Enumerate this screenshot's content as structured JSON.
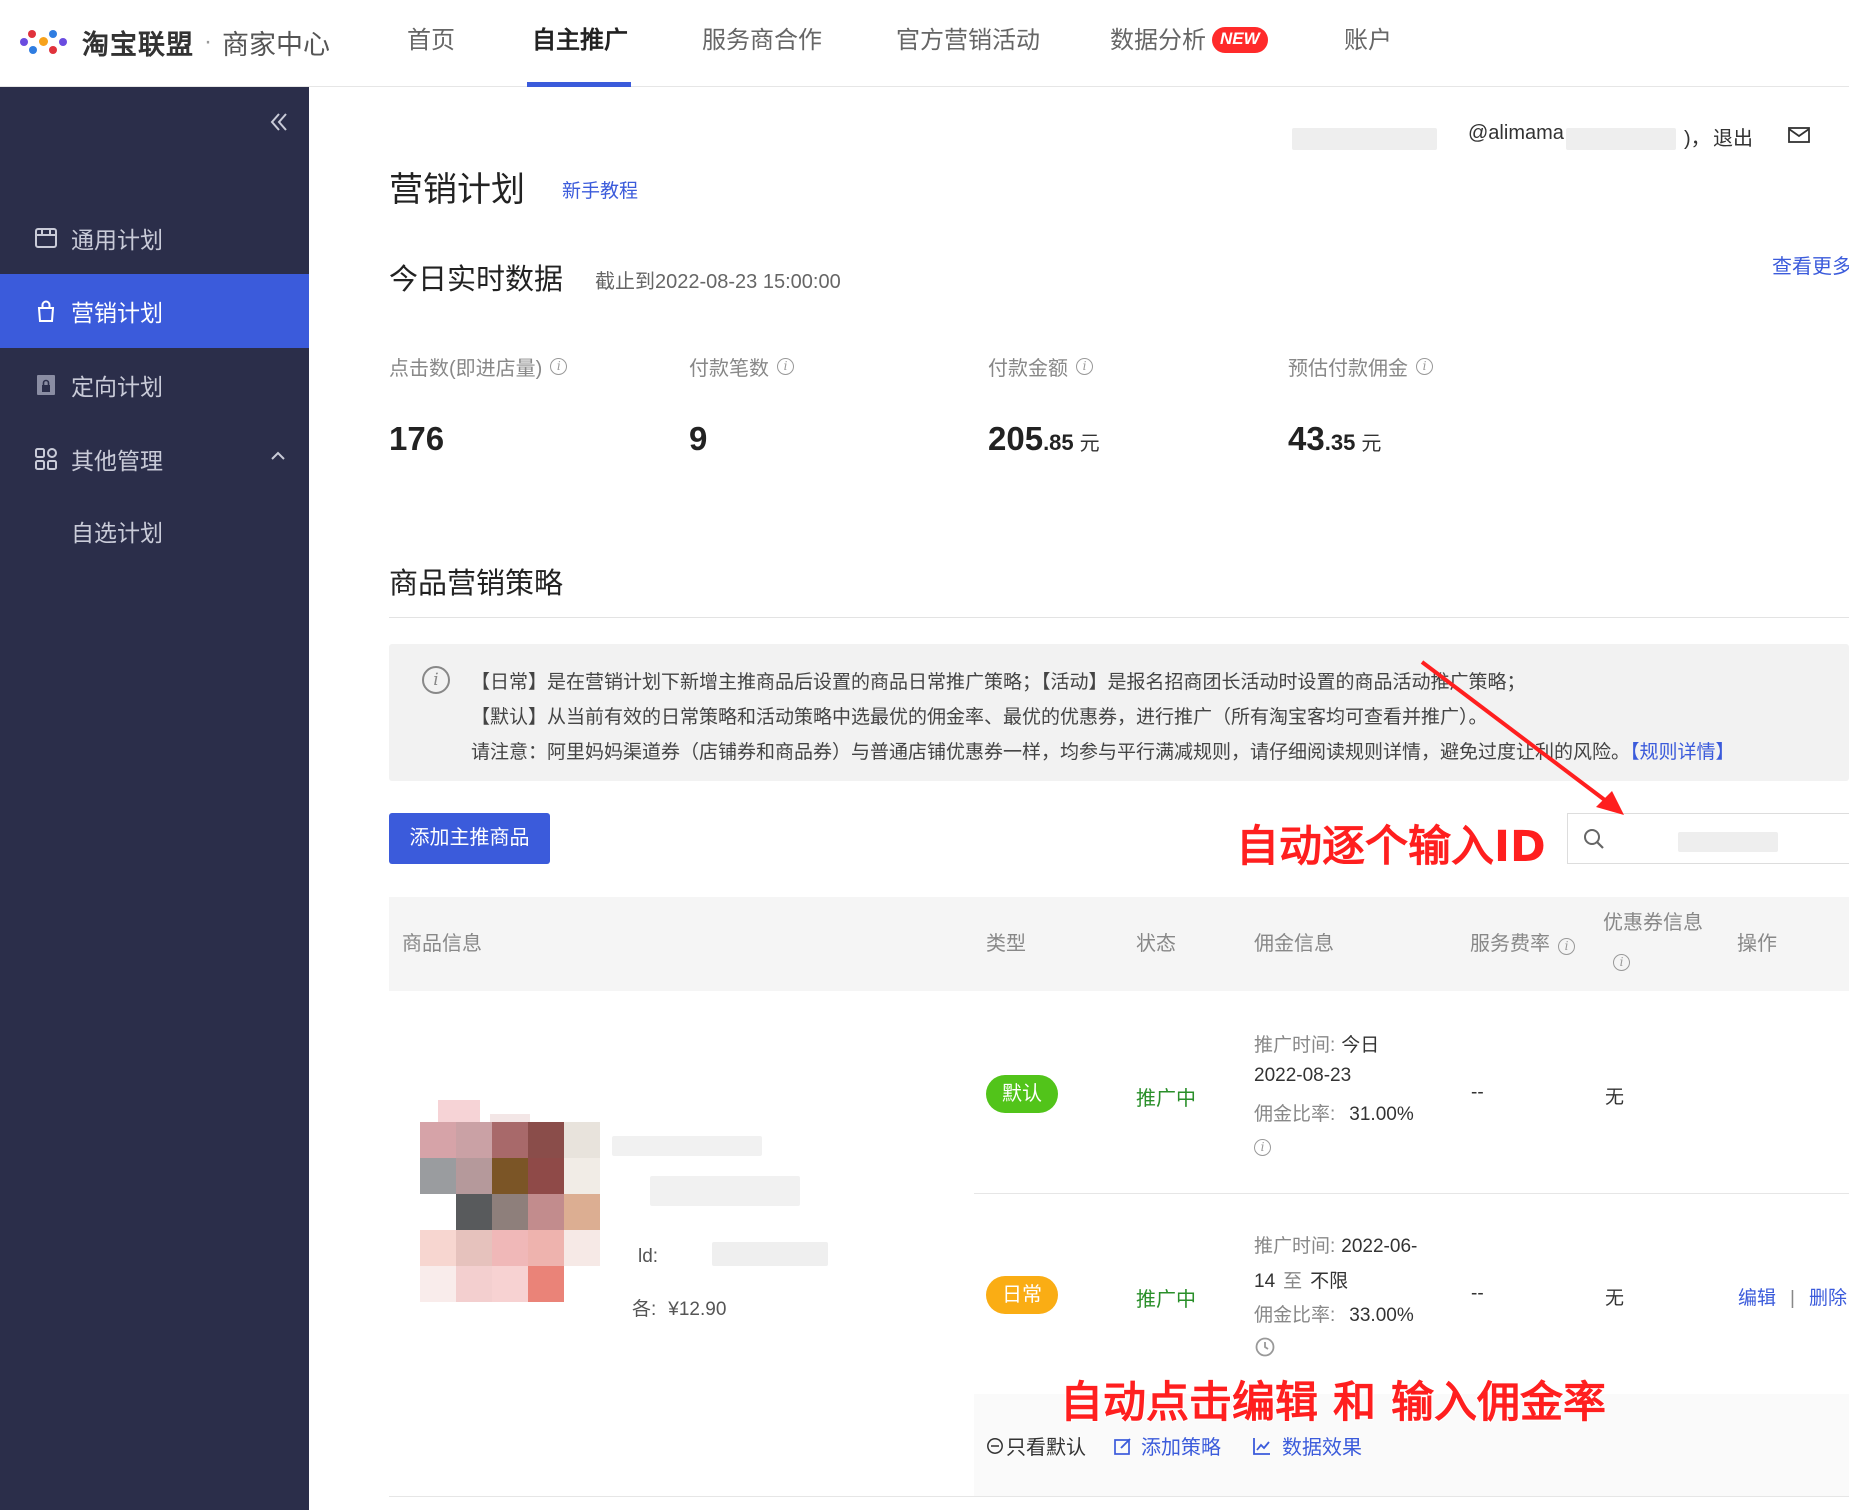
{
  "brand": {
    "title": "淘宝联盟",
    "separator": "·",
    "subtitle": "商家中心",
    "dot_colors": [
      "#e0323c",
      "#f7a21b",
      "#6a4ce0",
      "#2f7de1"
    ]
  },
  "topnav": {
    "items": [
      "首页",
      "自主推广",
      "服务商合作",
      "官方营销活动",
      "数据分析",
      "账户"
    ],
    "active": "自主推广",
    "new_badge": "NEW"
  },
  "sidebar": {
    "collapse_icon": "double-chevron-left-icon",
    "items": [
      {
        "label": "通用计划",
        "icon": "shop-icon"
      },
      {
        "label": "营销计划",
        "icon": "bag-icon"
      },
      {
        "label": "定向计划",
        "icon": "lock-page-icon"
      },
      {
        "label": "其他管理",
        "icon": "grid-apps-icon"
      }
    ],
    "sub_items": [
      "自选计划"
    ]
  },
  "user": {
    "account": "@alimama",
    "paren_close": ")，",
    "logout": "退出"
  },
  "page": {
    "title": "营销计划",
    "tutorial_link": "新手教程"
  },
  "realtime": {
    "title": "今日实时数据",
    "deadline": "截止到2022-08-23 15:00:00",
    "see_more": "查看更多",
    "metrics": [
      {
        "label": "点击数(即进店量)",
        "int": "176",
        "dec": "",
        "unit": ""
      },
      {
        "label": "付款笔数",
        "int": "9",
        "dec": "",
        "unit": ""
      },
      {
        "label": "付款金额",
        "int": "205",
        "dec": ".85",
        "unit": "元"
      },
      {
        "label": "预估付款佣金",
        "int": "43",
        "dec": ".35",
        "unit": "元"
      }
    ]
  },
  "strategy": {
    "title": "商品营销策略",
    "notice": {
      "line1": "【日常】是在营销计划下新增主推商品后设置的商品日常推广策略；【活动】是报名招商团长活动时设置的商品活动推广策略；",
      "line2": "【默认】从当前有效的日常策略和活动策略中选最优的佣金率、最优的优惠券，进行推广（所有淘宝客均可查看并推广）。",
      "line3": "请注意：阿里妈妈渠道券（店铺券和商品券）与普通店铺优惠券一样，均参与平行满减规则，请仔细阅读规则详情，避免过度让利的风险。",
      "link": "【规则详情】"
    },
    "add_button": "添加主推商品"
  },
  "annotations": {
    "search": "自动逐个输入ID",
    "edit": "自动点击编辑 和 输入佣金率"
  },
  "table": {
    "headers": {
      "product": "商品信息",
      "type": "类型",
      "status": "状态",
      "commission": "佣金信息",
      "service_rate": "服务费率",
      "coupon_line1": "优惠券信息",
      "operation": "操作"
    },
    "product": {
      "id_label": "ld:",
      "price_label": "各:",
      "price": "¥12.90"
    },
    "rows": [
      {
        "type": "默认",
        "type_color": "#52c41a",
        "status": "推广中",
        "time_label": "推广时间:",
        "time_line1": "今日",
        "time_line2": "2022-08-23",
        "rate_label": "佣金比率:",
        "rate": "31.00%",
        "service_rate": "--",
        "coupon": "无"
      },
      {
        "type": "日常",
        "type_color": "#faad14",
        "status": "推广中",
        "time_label": "推广时间:",
        "time_line1": "2022-06-",
        "time_line2_a": "14",
        "time_to": "至",
        "time_line2_b": "不限",
        "rate_label": "佣金比率:",
        "rate": "33.00%",
        "service_rate": "--",
        "coupon": "无",
        "ops": {
          "edit": "编辑",
          "sep": "|",
          "delete": "删除"
        }
      }
    ],
    "footer": {
      "only_default": "只看默认",
      "add_strategy": "添加策略",
      "data_effect": "数据效果"
    }
  }
}
